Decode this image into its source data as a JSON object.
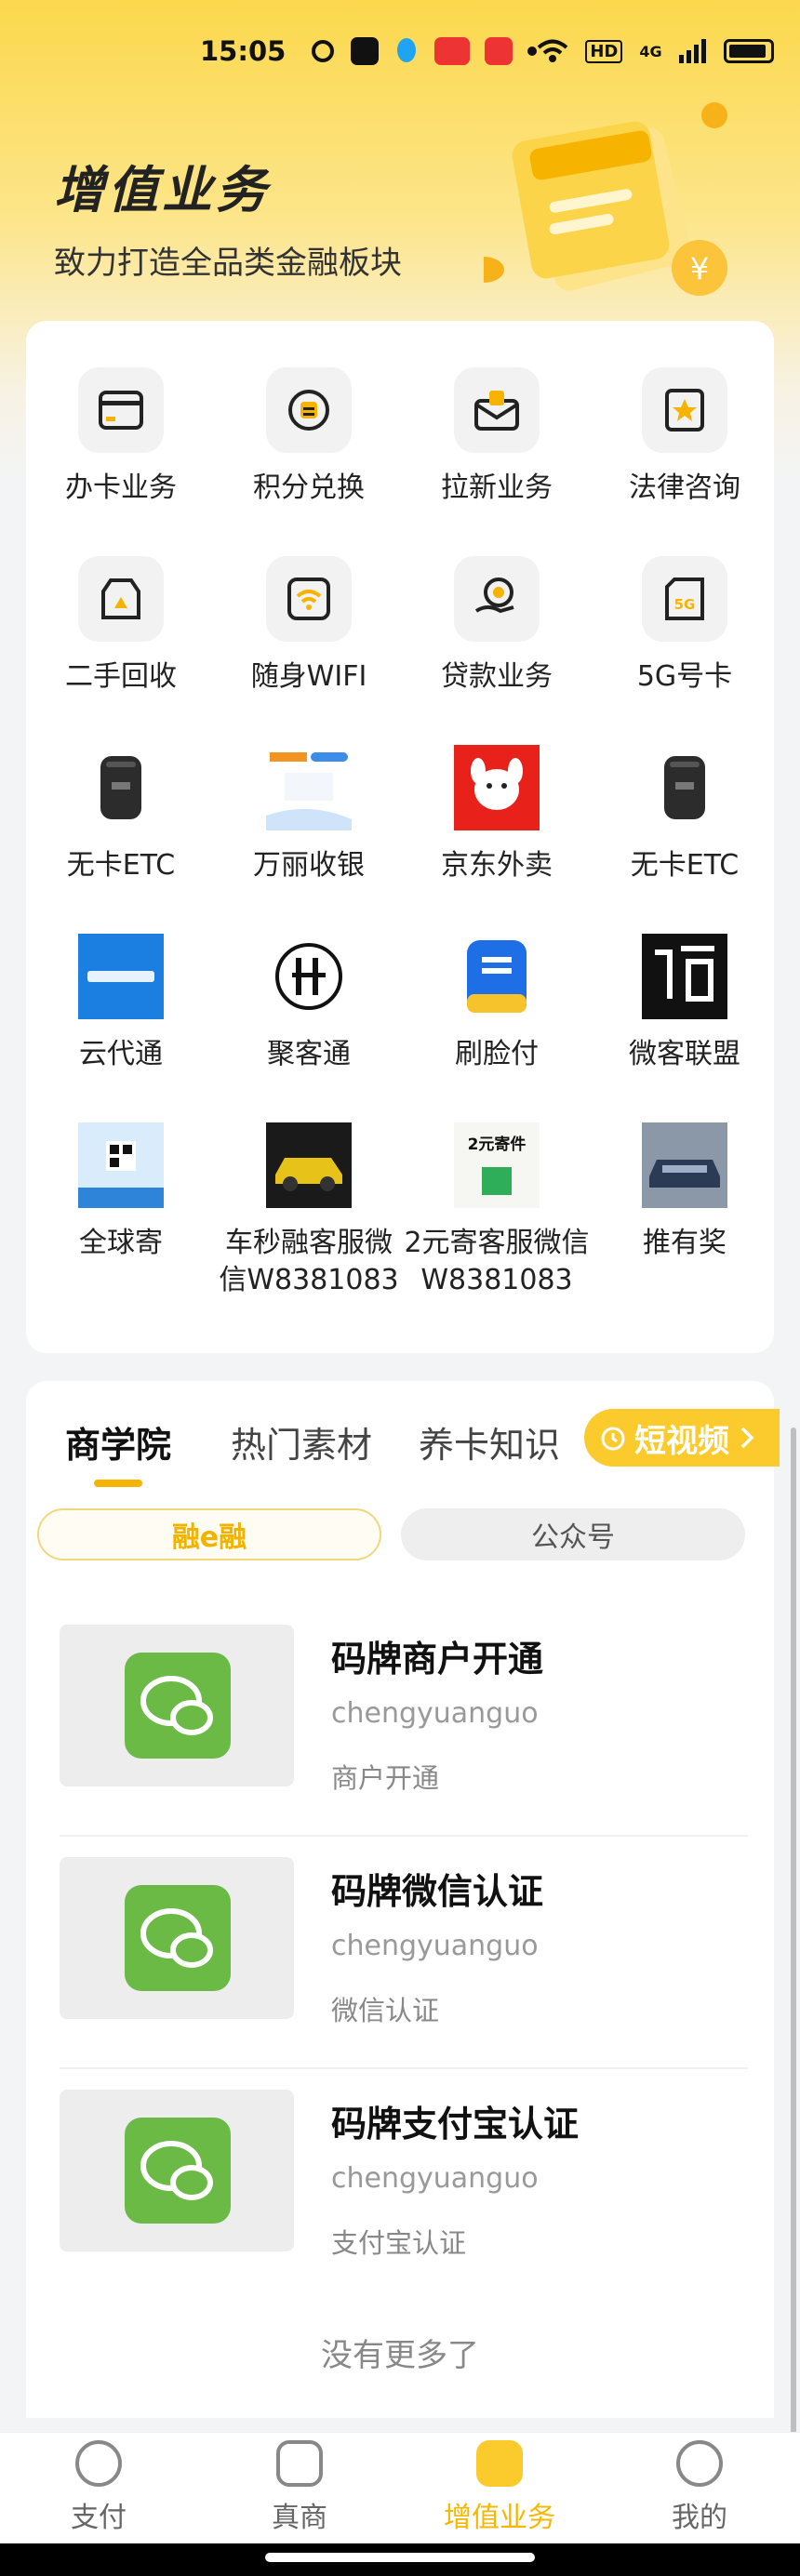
{
  "status_bar": {
    "time": "15:05",
    "app_icons": [
      "sync-icon",
      "tiktok-icon",
      "qq-icon",
      "toutiao-icon",
      "calendar-icon"
    ],
    "network_label": "HD",
    "signal_label": "4G"
  },
  "header": {
    "title": "增值业务",
    "subtitle": "致力打造全品类金融板块"
  },
  "grid": {
    "items": [
      {
        "label": "办卡业务",
        "icon": "card-icon"
      },
      {
        "label": "积分兑换",
        "icon": "coin-icon"
      },
      {
        "label": "拉新业务",
        "icon": "envelope-icon"
      },
      {
        "label": "法律咨询",
        "icon": "badge-icon"
      },
      {
        "label": "二手回收",
        "icon": "recycle-box-icon"
      },
      {
        "label": "随身WIFI",
        "icon": "wifi-icon"
      },
      {
        "label": "贷款业务",
        "icon": "loan-icon"
      },
      {
        "label": "5G号卡",
        "icon": "sim-card-icon"
      },
      {
        "label": "无卡ETC",
        "icon": "etc-device-image"
      },
      {
        "label": "万丽收银",
        "icon": "cashier-image"
      },
      {
        "label": "京东外卖",
        "icon": "jd-dog-image"
      },
      {
        "label": "无卡ETC",
        "icon": "etc-device-image"
      },
      {
        "label": "云代通",
        "icon": "yundaitong-logo"
      },
      {
        "label": "聚客通",
        "icon": "jukotong-logo"
      },
      {
        "label": "刷脸付",
        "icon": "face-pay-logo"
      },
      {
        "label": "微客联盟",
        "icon": "weike-logo"
      },
      {
        "label": "全球寄",
        "icon": "global-mail-image"
      },
      {
        "label": "车秒融客服微信W8381083",
        "icon": "car-image"
      },
      {
        "label": "2元寄客服微信W8381083",
        "icon": "two-yuan-mail-image"
      },
      {
        "label": "推有奖",
        "icon": "car-photo-image"
      }
    ],
    "two_yuan_image_text": "2元寄件"
  },
  "tabs": {
    "items": [
      "商学院",
      "热门素材",
      "养卡知识"
    ],
    "active_index": 0,
    "short_video": "短视频"
  },
  "sub_tabs": {
    "items": [
      "融e融",
      "公众号"
    ],
    "active_index": 0
  },
  "articles": [
    {
      "title": "码牌商户开通",
      "author": "chengyuanguo",
      "tag": "商户开通"
    },
    {
      "title": "码牌微信认证",
      "author": "chengyuanguo",
      "tag": "微信认证"
    },
    {
      "title": "码牌支付宝认证",
      "author": "chengyuanguo",
      "tag": "支付宝认证"
    }
  ],
  "no_more": "没有更多了",
  "bottom_nav": {
    "items": [
      {
        "label": "支付",
        "icon": "pay-face-icon"
      },
      {
        "label": "真商",
        "icon": "store-icon"
      },
      {
        "label": "增值业务",
        "icon": "value-added-icon"
      },
      {
        "label": "我的",
        "icon": "profile-icon"
      }
    ],
    "active_index": 2
  },
  "colors": {
    "accent": "#fbcb2e",
    "accent_text": "#f5b800",
    "wechat_green": "#6aba45"
  }
}
